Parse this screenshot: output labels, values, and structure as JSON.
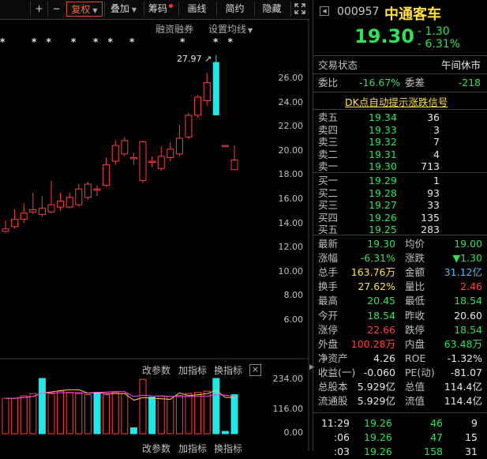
{
  "toolbar": {
    "plus": "+",
    "minus": "−",
    "fuquan": "复权",
    "diejia": "叠加",
    "chouma": "筹码",
    "huaxian": "画线",
    "jianyue": "简约",
    "yincang": "隐藏"
  },
  "chart": {
    "financing_label": "融资融券",
    "ma_setting_label": "设置均线",
    "peak_label": "27.97",
    "y_ticks": [
      "26.00",
      "24.00",
      "22.00",
      "20.00",
      "18.00",
      "16.00",
      "14.00",
      "12.00",
      "10.00",
      "8.00",
      "6.00"
    ],
    "sub_links": [
      "改参数",
      "加指标",
      "换指标"
    ],
    "vol_ticks": [
      "234.00",
      "116.00",
      "0.00"
    ],
    "close_glyph": "×",
    "candles": [
      {
        "o": 13.4,
        "c": 13.6,
        "h": 14.3,
        "l": 13.3
      },
      {
        "o": 13.8,
        "c": 14.4,
        "h": 15.2,
        "l": 13.6
      },
      {
        "o": 14.4,
        "c": 14.9,
        "h": 15.7,
        "l": 14.1
      },
      {
        "o": 15.0,
        "c": 15.2,
        "h": 16.6,
        "l": 14.8
      },
      {
        "o": 14.8,
        "c": 15.3,
        "h": 16.3,
        "l": 14.6
      },
      {
        "o": 15.0,
        "c": 15.6,
        "h": 17.6,
        "l": 14.9
      },
      {
        "o": 15.4,
        "c": 15.9,
        "h": 16.6,
        "l": 15.1
      },
      {
        "o": 15.4,
        "c": 16.2,
        "h": 16.6,
        "l": 15.3
      },
      {
        "o": 15.6,
        "c": 16.9,
        "h": 17.3,
        "l": 15.4
      },
      {
        "o": 16.2,
        "c": 17.3,
        "h": 17.5,
        "l": 16.0
      },
      {
        "o": 16.8,
        "c": 16.9,
        "h": 17.2,
        "l": 16.3
      },
      {
        "o": 17.2,
        "c": 18.9,
        "h": 19.5,
        "l": 17.1
      },
      {
        "o": 19.2,
        "c": 20.5,
        "h": 20.9,
        "l": 18.9
      },
      {
        "o": 19.8,
        "c": 20.9,
        "h": 21.2,
        "l": 19.6
      },
      {
        "o": 19.4,
        "c": 19.5,
        "h": 19.9,
        "l": 18.9
      },
      {
        "o": 17.6,
        "c": 20.8,
        "h": 20.9,
        "l": 17.4
      },
      {
        "o": 19.2,
        "c": 19.2,
        "h": 19.6,
        "l": 18.7
      },
      {
        "o": 18.6,
        "c": 19.6,
        "h": 20.4,
        "l": 18.4
      },
      {
        "o": 19.5,
        "c": 20.2,
        "h": 20.8,
        "l": 19.2
      },
      {
        "o": 19.8,
        "c": 21.1,
        "h": 22.2,
        "l": 19.6
      },
      {
        "o": 21.2,
        "c": 23.0,
        "h": 23.2,
        "l": 21.0
      },
      {
        "o": 23.0,
        "c": 24.5,
        "h": 24.7,
        "l": 22.8
      },
      {
        "o": 24.2,
        "c": 25.7,
        "h": 26.5,
        "l": 23.8
      },
      {
        "o": 27.4,
        "c": 23.0,
        "h": 27.97,
        "l": 23.0
      },
      {
        "o": 20.5,
        "c": 20.5,
        "h": 20.5,
        "l": 20.5
      },
      {
        "o": 18.5,
        "c": 19.3,
        "h": 20.5,
        "l": 18.5
      }
    ],
    "volume": [
      {
        "v": 150,
        "up": true
      },
      {
        "v": 150,
        "up": true
      },
      {
        "v": 160,
        "up": true
      },
      {
        "v": 170,
        "up": true
      },
      {
        "v": 234,
        "up": false
      },
      {
        "v": 170,
        "up": true
      },
      {
        "v": 180,
        "up": true
      },
      {
        "v": 175,
        "up": true
      },
      {
        "v": 170,
        "up": true
      },
      {
        "v": 165,
        "up": true
      },
      {
        "v": 175,
        "up": false
      },
      {
        "v": 165,
        "up": true
      },
      {
        "v": 175,
        "up": true
      },
      {
        "v": 170,
        "up": true
      },
      {
        "v": 25,
        "up": false
      },
      {
        "v": 230,
        "up": true
      },
      {
        "v": 155,
        "up": false
      },
      {
        "v": 160,
        "up": true
      },
      {
        "v": 158,
        "up": true
      },
      {
        "v": 162,
        "up": true
      },
      {
        "v": 170,
        "up": true
      },
      {
        "v": 175,
        "up": true
      },
      {
        "v": 180,
        "up": true
      },
      {
        "v": 234,
        "up": false
      },
      {
        "v": 10,
        "up": false
      },
      {
        "v": 165,
        "up": false
      }
    ]
  },
  "quote": {
    "code": "000957",
    "name": "中通客车",
    "price": "19.30",
    "change": "- 1.30",
    "change_pct": "- 6.31%",
    "trade_state_label": "交易状态",
    "trade_state_value": "午间休市",
    "weibi_label": "委比",
    "weibi_value": "-16.67%",
    "weicha_label": "委差",
    "weicha_value": "-218",
    "signal_link": "DK点自动提示涨跌信号"
  },
  "order_book": {
    "asks": [
      {
        "label": "卖五",
        "price": "19.34",
        "vol": "36"
      },
      {
        "label": "卖四",
        "price": "19.33",
        "vol": "3"
      },
      {
        "label": "卖三",
        "price": "19.32",
        "vol": "7"
      },
      {
        "label": "卖二",
        "price": "19.31",
        "vol": "4"
      },
      {
        "label": "卖一",
        "price": "19.30",
        "vol": "713"
      }
    ],
    "bids": [
      {
        "label": "买一",
        "price": "19.29",
        "vol": "1"
      },
      {
        "label": "买二",
        "price": "19.28",
        "vol": "93"
      },
      {
        "label": "买三",
        "price": "19.27",
        "vol": "33"
      },
      {
        "label": "买四",
        "price": "19.26",
        "vol": "135"
      },
      {
        "label": "买五",
        "price": "19.25",
        "vol": "283"
      }
    ]
  },
  "stats": [
    {
      "l1": "最新",
      "v1": "19.30",
      "c1": "green",
      "l2": "均价",
      "v2": "19.00",
      "c2": "green"
    },
    {
      "l1": "涨幅",
      "v1": "-6.31%",
      "c1": "green",
      "l2": "涨跌",
      "v2": "▼1.30",
      "c2": "green"
    },
    {
      "l1": "总手",
      "v1": "163.76万",
      "c1": "yellow",
      "l2": "金额",
      "v2": "31.12亿",
      "c2": "blue"
    },
    {
      "l1": "换手",
      "v1": "27.62%",
      "c1": "yellow",
      "l2": "量比",
      "v2": "2.46",
      "c2": "red"
    },
    {
      "l1": "最高",
      "v1": "20.45",
      "c1": "green",
      "l2": "最低",
      "v2": "18.54",
      "c2": "green"
    },
    {
      "l1": "今开",
      "v1": "18.54",
      "c1": "green",
      "l2": "昨收",
      "v2": "20.60",
      "c2": "white"
    },
    {
      "l1": "涨停",
      "v1": "22.66",
      "c1": "red",
      "l2": "跌停",
      "v2": "18.54",
      "c2": "green"
    },
    {
      "l1": "外盘",
      "v1": "100.28万",
      "c1": "red",
      "l2": "内盘",
      "v2": "63.48万",
      "c2": "green"
    },
    {
      "l1": "净资产",
      "v1": "4.26",
      "c1": "white",
      "l2": "ROE",
      "v2": "-1.32%",
      "c2": "white"
    },
    {
      "l1": "收益(一)",
      "v1": "-0.060",
      "c1": "white",
      "l2": "PE(动)",
      "v2": "-81.07",
      "c2": "white"
    },
    {
      "l1": "总股本",
      "v1": "5.929亿",
      "c1": "white",
      "l2": "总值",
      "v2": "114.4亿",
      "c2": "white"
    },
    {
      "l1": "流通股",
      "v1": "5.929亿",
      "c1": "white",
      "l2": "流值",
      "v2": "114.4亿",
      "c2": "white"
    }
  ],
  "ticks": [
    {
      "time": "11:29",
      "price": "19.26",
      "vol": "46",
      "n": "9"
    },
    {
      "time": ":06",
      "price": "19.26",
      "vol": "47",
      "n": "15"
    },
    {
      "time": ":03",
      "price": "19.26",
      "vol": "158",
      "n": "31"
    }
  ],
  "colors": {
    "up": "#ff3c3c",
    "down": "#20e8e8",
    "ma1": "#e8e8e8",
    "ma2": "#ffd23a",
    "ma3": "#ff40ff"
  }
}
